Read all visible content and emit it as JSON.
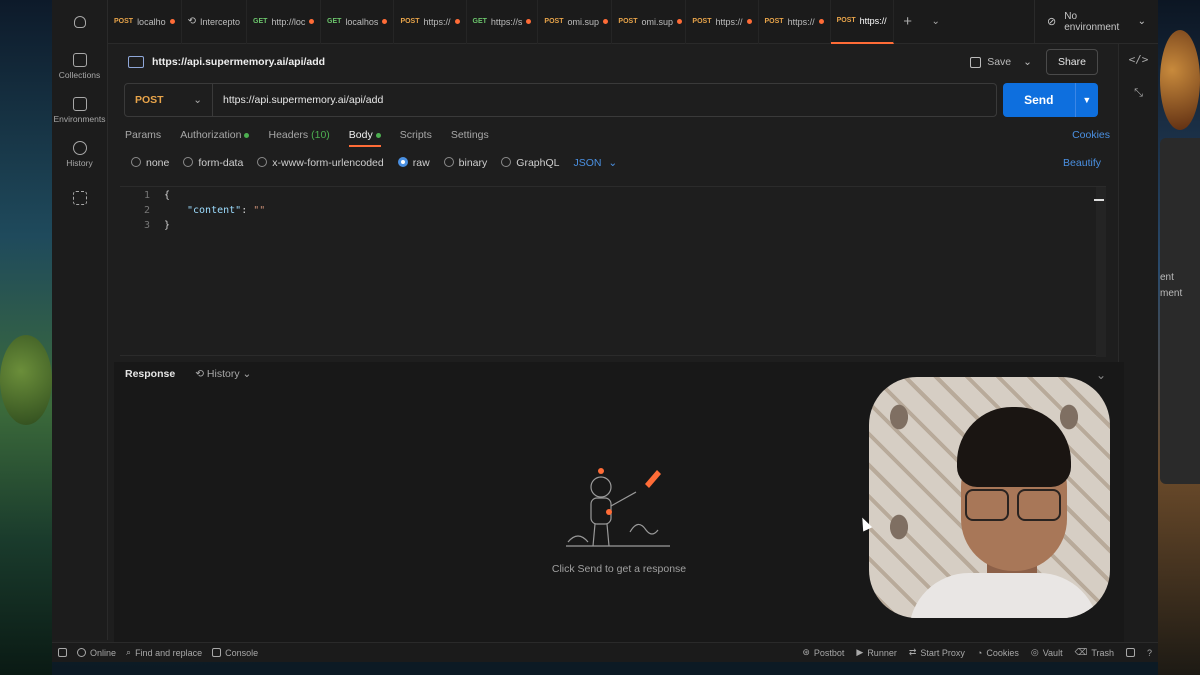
{
  "rail": [
    {
      "label": "",
      "icon": "person-icon"
    },
    {
      "label": "Collections",
      "icon": "trash-can-icon"
    },
    {
      "label": "Environments",
      "icon": "environment-icon"
    },
    {
      "label": "History",
      "icon": "history-icon"
    },
    {
      "label": "",
      "icon": "grid-add-icon"
    }
  ],
  "tabs": [
    {
      "method": "POST",
      "label": "localho"
    },
    {
      "method": "",
      "label": "Intercepto"
    },
    {
      "method": "GET",
      "label": "http://loc"
    },
    {
      "method": "GET",
      "label": "localhos"
    },
    {
      "method": "POST",
      "label": "https://"
    },
    {
      "method": "GET",
      "label": "https://s"
    },
    {
      "method": "POST",
      "label": "omi.sup"
    },
    {
      "method": "POST",
      "label": "omi.sup"
    },
    {
      "method": "POST",
      "label": "https://"
    },
    {
      "method": "POST",
      "label": "https://"
    },
    {
      "method": "POST",
      "label": "https://"
    }
  ],
  "environment": "No environment",
  "request": {
    "title": "https://api.supermemory.ai/api/add",
    "save": "Save",
    "share": "Share",
    "method": "POST",
    "url": "https://api.supermemory.ai/api/add",
    "send": "Send"
  },
  "subtabs": {
    "params": "Params",
    "authorization": "Authorization",
    "headers": "Headers",
    "headers_count": "(10)",
    "body": "Body",
    "scripts": "Scripts",
    "settings": "Settings",
    "cookies": "Cookies"
  },
  "body_types": {
    "none": "none",
    "form_data": "form-data",
    "urlencoded": "x-www-form-urlencoded",
    "raw": "raw",
    "binary": "binary",
    "graphql": "GraphQL",
    "language": "JSON",
    "beautify": "Beautify",
    "selected": "raw"
  },
  "editor": {
    "lines": [
      "1",
      "2",
      "3"
    ],
    "line1": "{",
    "key": "\"content\"",
    "colon": ": ",
    "value": "\"\"",
    "line3": "}"
  },
  "response": {
    "title": "Response",
    "history": "History",
    "empty_message": "Click Send to get a response"
  },
  "statusbar": {
    "online": "Online",
    "find_replace": "Find and replace",
    "console": "Console",
    "postbot": "Postbot",
    "runner": "Runner",
    "start_proxy": "Start Proxy",
    "cookies": "Cookies",
    "vault": "Vault",
    "trash": "Trash"
  },
  "background_window": {
    "line1": "ent",
    "line2": "ment"
  },
  "colors": {
    "accent": "#ff6c37",
    "send": "#0e6fde",
    "post": "#e8a44a",
    "get": "#6bc46b",
    "link": "#4a90e2"
  }
}
